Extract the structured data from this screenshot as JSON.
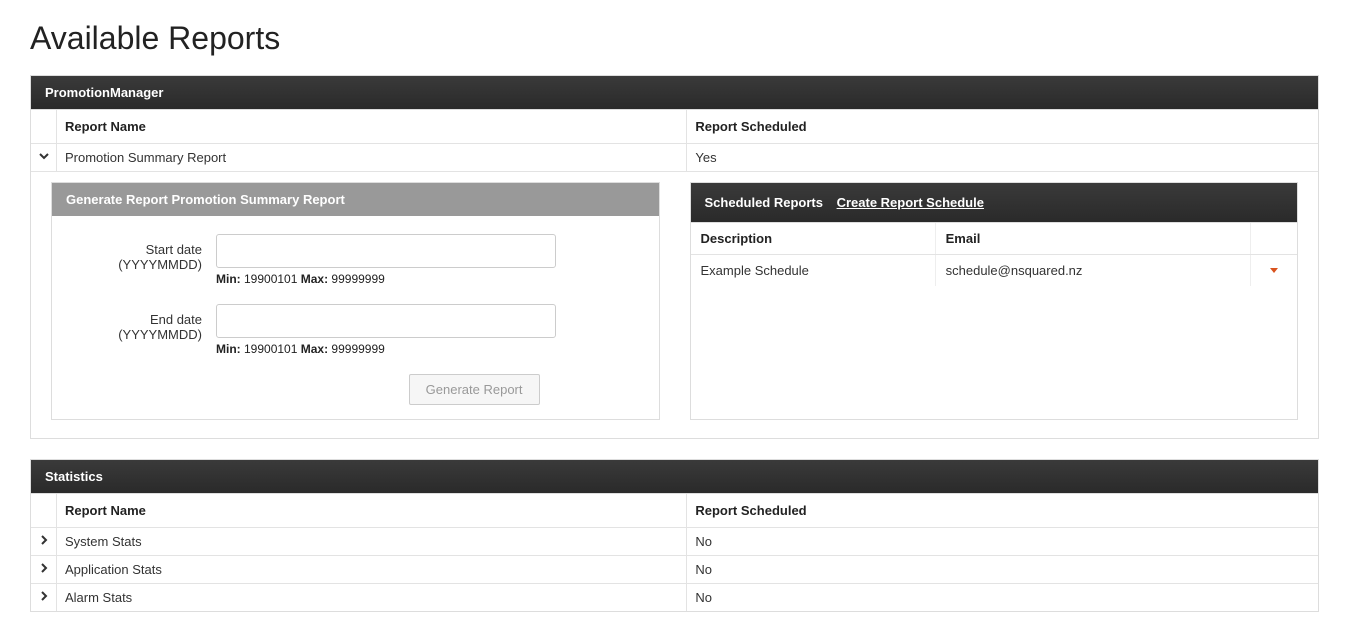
{
  "page_title": "Available Reports",
  "sections": {
    "promotion": {
      "title": "PromotionManager",
      "columns": {
        "name": "Report Name",
        "scheduled": "Report Scheduled"
      },
      "rows": [
        {
          "name": "Promotion Summary Report",
          "scheduled": "Yes"
        }
      ],
      "generate": {
        "title": "Generate Report Promotion Summary Report",
        "start_label": "Start date (YYYYMMDD)",
        "end_label": "End date (YYYYMMDD)",
        "min_label": "Min:",
        "min_value": "19900101",
        "max_label": "Max:",
        "max_value": "99999999",
        "button": "Generate Report"
      },
      "schedule_panel": {
        "title": "Scheduled Reports",
        "create_link": "Create Report Schedule",
        "columns": {
          "desc": "Description",
          "email": "Email"
        },
        "rows": [
          {
            "desc": "Example Schedule",
            "email": "schedule@nsquared.nz"
          }
        ]
      }
    },
    "statistics": {
      "title": "Statistics",
      "columns": {
        "name": "Report Name",
        "scheduled": "Report Scheduled"
      },
      "rows": [
        {
          "name": "System Stats",
          "scheduled": "No"
        },
        {
          "name": "Application Stats",
          "scheduled": "No"
        },
        {
          "name": "Alarm Stats",
          "scheduled": "No"
        }
      ]
    }
  }
}
